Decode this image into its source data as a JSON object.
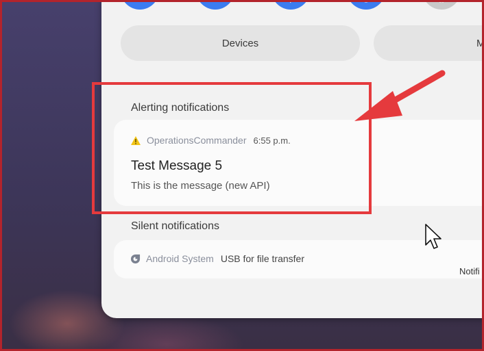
{
  "quick_settings": {
    "tiles": [
      {
        "icon": "wifi-icon",
        "state": "on"
      },
      {
        "icon": "volume-icon",
        "state": "on"
      },
      {
        "icon": "bluetooth-icon",
        "state": "on"
      },
      {
        "icon": "auto-rotate-icon",
        "state": "on"
      },
      {
        "icon": "airplane-icon",
        "state": "off"
      }
    ],
    "devices_label": "Devices",
    "media_label_partial": "M"
  },
  "alerting": {
    "title": "Alerting notifications",
    "notification": {
      "app_icon": "warning-icon",
      "app_name": "OperationsCommander",
      "time": "6:55 p.m.",
      "title": "Test Message 5",
      "body": "This is the message (new API)"
    }
  },
  "silent": {
    "title": "Silent notifications",
    "notification": {
      "app_icon": "android-system-icon",
      "app_name": "Android System",
      "text": "USB for file transfer"
    }
  },
  "footer": {
    "label_partial": "Notifi"
  },
  "colors": {
    "accent_blue": "#3b7cf0",
    "highlight_red": "#e53a3d",
    "warning_yellow": "#f2c418",
    "frame_red": "#b3242c"
  }
}
